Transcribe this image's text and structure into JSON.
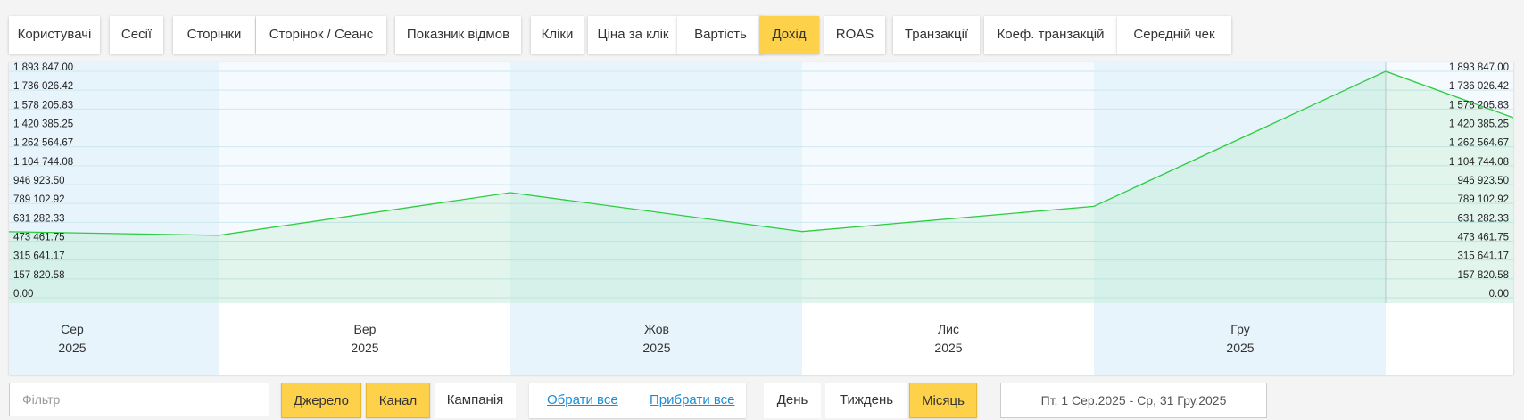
{
  "metric_tabs": [
    {
      "label": "Користувачі",
      "active": false
    },
    {
      "label": "Сесії",
      "active": false
    },
    {
      "label": "Сторінки",
      "active": false
    },
    {
      "label": "Сторінок / Сеанс",
      "active": false
    },
    {
      "label": "Показник відмов",
      "active": false
    },
    {
      "label": "Кліки",
      "active": false
    },
    {
      "label": "Ціна за клік",
      "active": false
    },
    {
      "label": "Вартість",
      "active": false
    },
    {
      "label": "Дохід",
      "active": true
    },
    {
      "label": "ROAS",
      "active": false
    },
    {
      "label": "Транзакції",
      "active": false
    },
    {
      "label": "Коеф. транзакцій",
      "active": false
    },
    {
      "label": "Середній чек",
      "active": false
    }
  ],
  "chart_data": {
    "type": "area",
    "metric": "Дохід",
    "categories": [
      {
        "month": "Сер",
        "year": "2025"
      },
      {
        "month": "Вер",
        "year": "2025"
      },
      {
        "month": "Жов",
        "year": "2025"
      },
      {
        "month": "Лис",
        "year": "2025"
      },
      {
        "month": "Гру",
        "year": "2025"
      }
    ],
    "series": [
      {
        "values": [
          523000,
          880000,
          554000,
          765000,
          1893847
        ]
      }
    ],
    "y_ticks": [
      "1 893 847.00",
      "1 736 026.42",
      "1 578 205.83",
      "1 420 385.25",
      "1 262 564.67",
      "1 104 744.08",
      "946 923.50",
      "789 102.92",
      "631 282.33",
      "473 461.75",
      "315 641.17",
      "157 820.58",
      "0.00"
    ],
    "ylim": [
      0,
      1893847
    ],
    "grid": true,
    "colors": {
      "line": "#2ecc40",
      "fill": "#2ecc40",
      "band_odd": "#e7f4fb",
      "band_even": "#f4fafd",
      "grid": "#cfe7ef"
    }
  },
  "controls": {
    "filter_placeholder": "Фільтр",
    "group_by": [
      {
        "label": "Джерело",
        "active": true
      },
      {
        "label": "Канал",
        "active": true
      },
      {
        "label": "Кампанія",
        "active": false
      }
    ],
    "select_all": "Обрати все",
    "deselect_all": "Прибрати все",
    "granularity": [
      {
        "label": "День",
        "active": false
      },
      {
        "label": "Тиждень",
        "active": false
      },
      {
        "label": "Місяць",
        "active": true
      }
    ],
    "date_range": "Пт, 1 Сер.2025 - Ср, 31 Гру.2025"
  }
}
